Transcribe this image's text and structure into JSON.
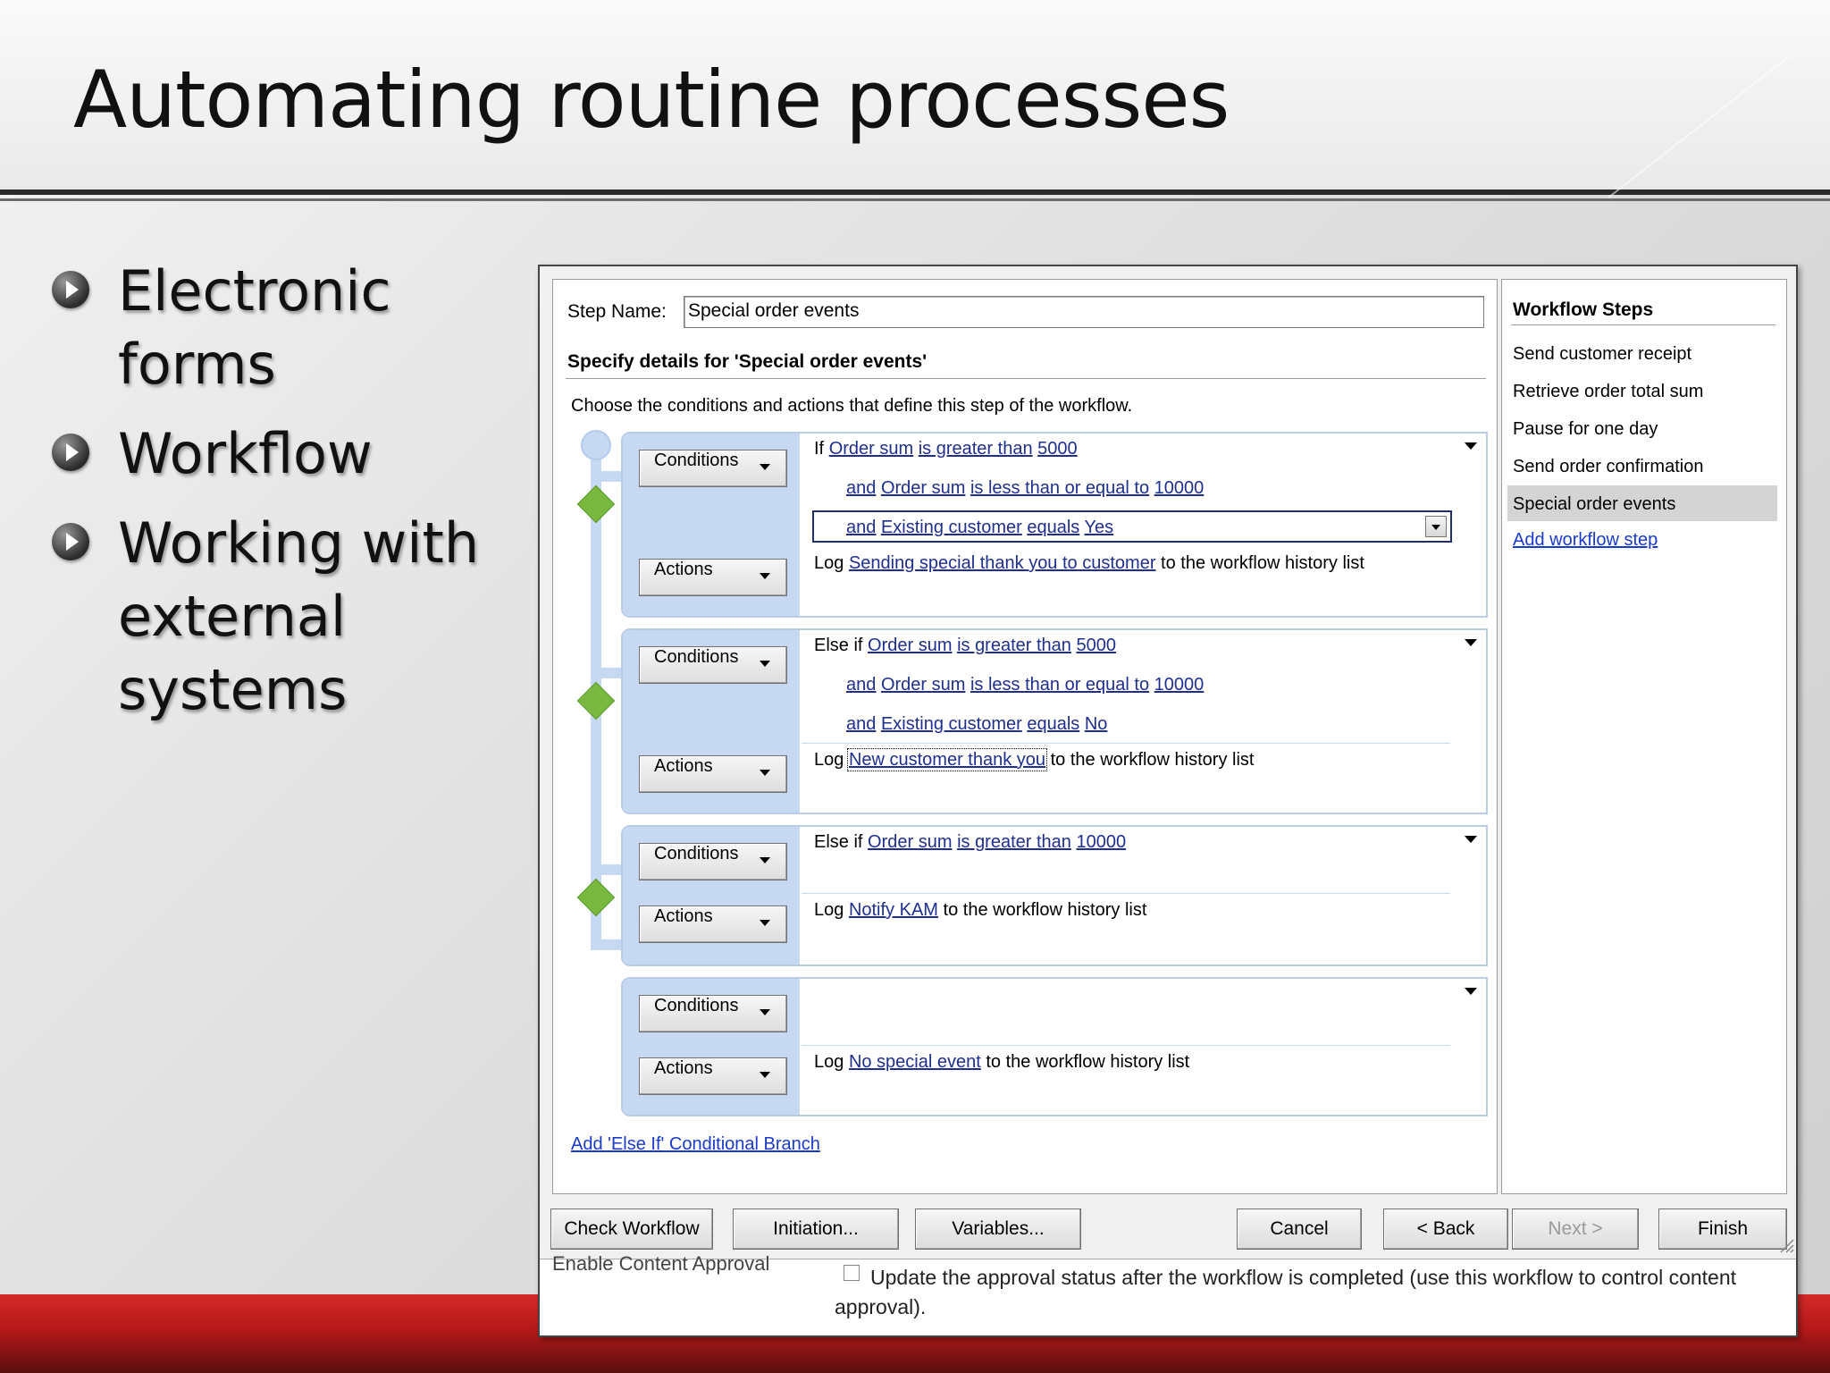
{
  "slide": {
    "title": "Automating routine processes",
    "bullets": [
      "Electronic forms",
      "Workflow",
      "Working with external systems"
    ]
  },
  "dialog": {
    "step_name_label": "Step Name:",
    "step_name_value": "Special order events",
    "specify_title": "Specify details for 'Special order events'",
    "choose_text": "Choose the conditions and actions that define this step of the workflow.",
    "conditions_label": "Conditions",
    "actions_label": "Actions",
    "branches": [
      {
        "conditions": [
          {
            "prefix": "If",
            "field": "Order sum",
            "op": "is greater than",
            "value": "5000"
          },
          {
            "prefix": "and",
            "field": "Order sum",
            "op": "is less than or equal to",
            "value": "10000"
          },
          {
            "prefix": "and",
            "field": "Existing customer",
            "op": "equals",
            "value": "Yes"
          }
        ],
        "action": {
          "verb": "Log",
          "message": "Sending special thank you to customer",
          "suffix": "to the workflow history list"
        }
      },
      {
        "conditions": [
          {
            "prefix": "Else if",
            "field": "Order sum",
            "op": "is greater than",
            "value": "5000"
          },
          {
            "prefix": "and",
            "field": "Order sum",
            "op": "is less than or equal to",
            "value": "10000"
          },
          {
            "prefix": "and",
            "field": "Existing customer",
            "op": "equals",
            "value": "No"
          }
        ],
        "action": {
          "verb": "Log",
          "message": "New customer thank you",
          "suffix": "to the workflow history list"
        }
      },
      {
        "conditions": [
          {
            "prefix": "Else if",
            "field": "Order sum",
            "op": "is greater than",
            "value": "10000"
          }
        ],
        "action": {
          "verb": "Log",
          "message": "Notify KAM",
          "suffix": "to the workflow history list"
        }
      },
      {
        "conditions": [],
        "action": {
          "verb": "Log",
          "message": "No special event",
          "suffix": "to the workflow history list"
        }
      }
    ],
    "add_branch_link": "Add 'Else If' Conditional Branch",
    "steps_title": "Workflow Steps",
    "steps": [
      "Send customer receipt",
      "Retrieve order total sum",
      "Pause for one day",
      "Send order confirmation",
      "Special order events"
    ],
    "selected_step_index": 4,
    "add_step_link": "Add workflow step",
    "buttons": {
      "check": "Check Workflow",
      "initiation": "Initiation...",
      "variables": "Variables...",
      "cancel": "Cancel",
      "back": "< Back",
      "next": "Next >",
      "finish": "Finish"
    },
    "underlying": {
      "label": "Enable Content Approval",
      "text": "Update the approval status after the workflow is completed (use this workflow to control content approval)."
    }
  }
}
